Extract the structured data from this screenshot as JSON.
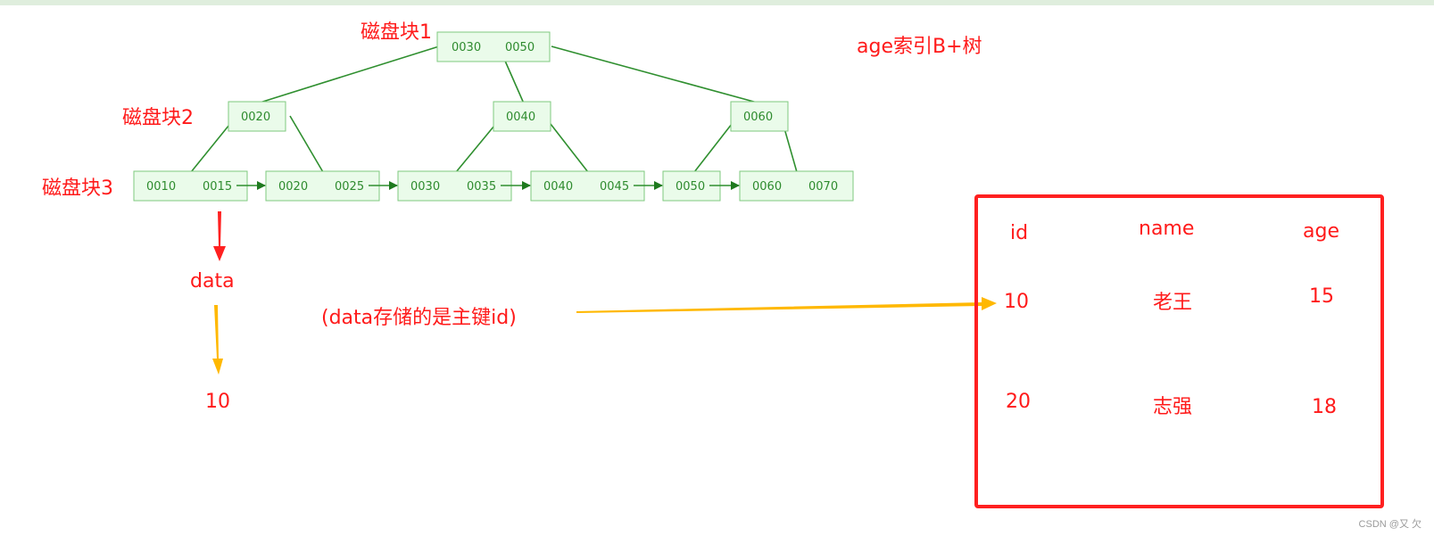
{
  "title": "age索引B+树",
  "labels": {
    "disk1": "磁盘块1",
    "disk2": "磁盘块2",
    "disk3": "磁盘块3",
    "data": "data",
    "data_value": "10",
    "note": "(data存储的是主键id)"
  },
  "tree": {
    "root": [
      "0030",
      "0050"
    ],
    "level2": [
      [
        "0020"
      ],
      [
        "0040"
      ],
      [
        "0060"
      ]
    ],
    "leaves": [
      [
        "0010",
        "0015"
      ],
      [
        "0020",
        "0025"
      ],
      [
        "0030",
        "0035"
      ],
      [
        "0040",
        "0045"
      ],
      [
        "0050"
      ],
      [
        "0060",
        "0070"
      ]
    ]
  },
  "table": {
    "headers": [
      "id",
      "name",
      "age"
    ],
    "rows": [
      [
        "10",
        "老王",
        "15"
      ],
      [
        "20",
        "志强",
        "18"
      ]
    ]
  },
  "colors": {
    "annotation": "#ff1a1a",
    "node_fill": "#eafbea",
    "node_border": "#7fc97f",
    "edge": "#2f8f2f",
    "red_arrow": "#ff2020",
    "yellow_arrow": "#ffb800"
  },
  "watermark": "CSDN @又 欠"
}
